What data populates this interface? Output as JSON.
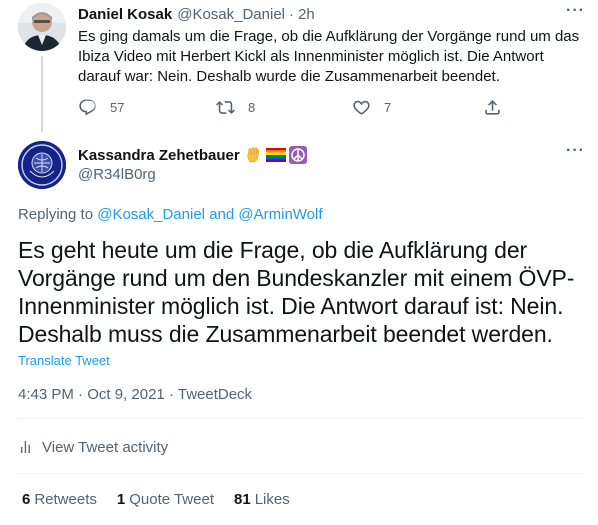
{
  "parent_tweet": {
    "name": "Daniel Kosak",
    "handle": "@Kosak_Daniel",
    "separator": "·",
    "time": "2h",
    "more": "···",
    "text": "Es ging damals um die Frage, ob die Aufklärung der Vorgänge rund um das Ibiza Video mit Herbert Kickl als Innenminister möglich ist. Die Antwort darauf war: Nein. Deshalb wurde die Zusammenarbeit beendet.",
    "reply_count": "57",
    "retweet_count": "8",
    "like_count": "7"
  },
  "main_tweet": {
    "name": "Kassandra Zehetbauer",
    "handle": "@R34lB0rg",
    "more": "···",
    "replying_prefix": "Replying to",
    "replying_user1": "@Kosak_Daniel",
    "replying_and": "and",
    "replying_user2": "@ArminWolf",
    "text": "Es geht heute um die Frage, ob die Aufklärung der Vorgänge rund um den Bundeskanzler mit einem ÖVP-Innenminister möglich ist. Die Antwort darauf ist: Nein. Deshalb muss die Zusammenarbeit beendet werden.",
    "translate_label": "Translate Tweet",
    "time": "4:43 PM",
    "date": "Oct 9, 2021",
    "source": "TweetDeck",
    "meta_separator": "·",
    "activity_label": "View Tweet activity",
    "stats": {
      "retweets_count": "6",
      "retweets_label": "Retweets",
      "quotes_count": "1",
      "quotes_label": "Quote Tweet",
      "likes_count": "81",
      "likes_label": "Likes"
    }
  },
  "colors": {
    "accent": "#1d9bf0",
    "muted": "#536471",
    "text": "#0f1419",
    "divider": "#eff3f4"
  },
  "icons": {
    "reply": "reply-icon",
    "retweet": "retweet-icon",
    "like": "heart-icon",
    "share": "share-icon",
    "more": "more-icon",
    "activity": "bar-chart-icon",
    "badge_hand": "vulcan-salute-icon",
    "badge_flag": "rainbow-flag-icon",
    "badge_peace": "peace-symbol-icon"
  }
}
